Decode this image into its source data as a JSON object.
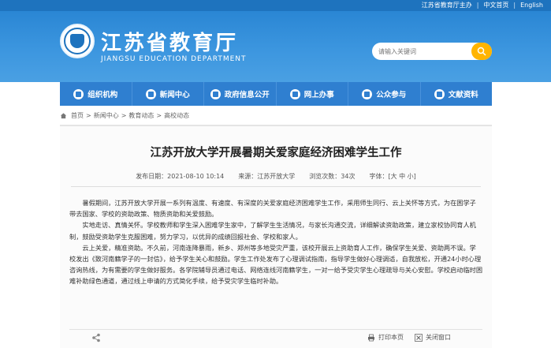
{
  "topbar": {
    "sponsor": "江苏省教育厅主办",
    "lang_cn": "中文首页",
    "lang_en": "English"
  },
  "header": {
    "title": "江苏省教育厅",
    "subtitle": "JIANGSU EDUCATION DEPARTMENT",
    "search_placeholder": "请输入关键词"
  },
  "nav": {
    "items": [
      {
        "label": "组织机构"
      },
      {
        "label": "新闻中心"
      },
      {
        "label": "政府信息公开"
      },
      {
        "label": "网上办事"
      },
      {
        "label": "公众参与"
      },
      {
        "label": "文献资料"
      }
    ]
  },
  "breadcrumb": [
    "首页",
    "新闻中心",
    "教育动态",
    "高校动态"
  ],
  "article": {
    "title": "江苏开放大学开展暑期关爱家庭经济困难学生工作",
    "publish_label": "发布日期：2021-08-10 10:14",
    "source_label": "来源：江苏开放大学",
    "views_label": "浏览次数：34次",
    "font_label": "字体：[大 中 小]",
    "paragraphs": [
      "暑假期间，江苏开放大学开展一系列有温度、有速度、有深度的关爱家庭经济困难学生工作，采用师生同行、云上关怀等方式，为在困学子带去国家、学校的资助政策、物质资助和关爱鼓励。",
      "实地走访、真情关怀。学校教师和学生深入困难学生家中，了解学生生活情况，与家长沟通交流，详细解读资助政策，建立家校协同育人机制，鼓励受资助学生克服困难，努力学习，以优异的成绩回报社会、学校和家人。",
      "云上关爱，精准资助。不久前，河南连降暴雨，新乡、郑州等多地受灾严重，该校开展云上资助育人工作，确保学生关爱、资助两不误。学校发出《致河南籍学子的一封信》，给予学生关心和鼓励。学生工作处发布了心理调试指南，指导学生做好心理调适，自我放松，开通24小时心理咨询热线，为有需要的学生做好服务。各学院辅导员通过电话、网络连线河南籍学生，一对一给予受灾学生心理疏导与关心安慰。学校启动临时困难补助绿色通道，通过线上申请的方式简化手续，给予受灾学生临时补助。"
    ]
  },
  "tools": {
    "print_label": "打印本页",
    "close_label": "关闭窗口"
  },
  "colors": {
    "brand_blue": "#1e73be",
    "nav_blue": "#2f7fd0",
    "search_button": "#ffb400"
  }
}
